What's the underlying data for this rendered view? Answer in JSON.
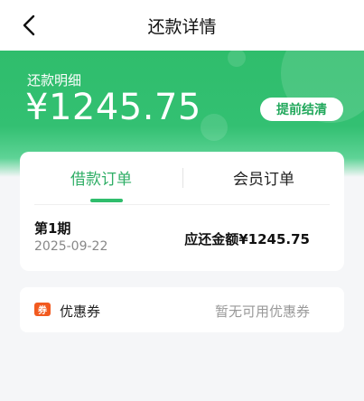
{
  "header": {
    "title": "还款详情",
    "back_icon": "chevron-left-icon"
  },
  "hero": {
    "label": "还款明细",
    "amount": "¥1245.75",
    "prepay_button": "提前结清",
    "accent_color": "#2fbd6c"
  },
  "tabs": [
    {
      "label": "借款订单",
      "active": true
    },
    {
      "label": "会员订单",
      "active": false
    }
  ],
  "installment": {
    "period": "第1期",
    "date": "2025-09-22",
    "amount_due": "应还金额¥1245.75"
  },
  "coupon": {
    "icon_text": "券",
    "label": "优惠券",
    "status": "暂无可用优惠券",
    "icon_color": "#f25a1f"
  }
}
